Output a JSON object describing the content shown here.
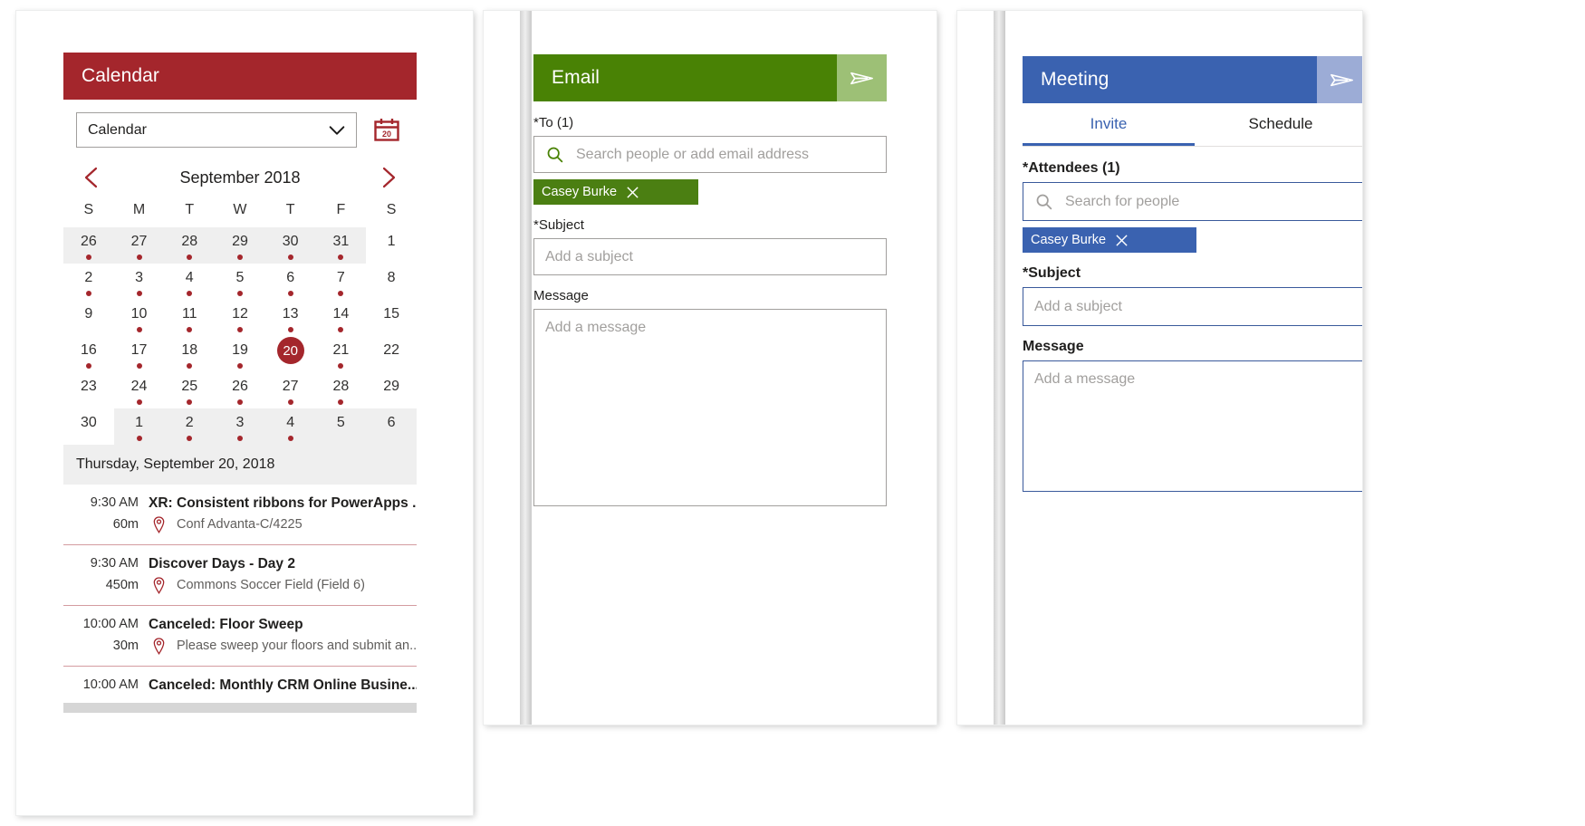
{
  "calendar_panel": {
    "header": {
      "title": "Calendar"
    },
    "selector": {
      "value": "Calendar",
      "chevron_icon": "chevron-down-icon"
    },
    "today_button": {
      "icon": "calendar-date-icon",
      "day": "20"
    },
    "month_nav": {
      "prev_icon": "chevron-left-icon",
      "next_icon": "chevron-right-icon",
      "label": "September 2018"
    },
    "weekday_headers": [
      "S",
      "M",
      "T",
      "W",
      "T",
      "F",
      "S"
    ],
    "weeks": [
      [
        {
          "n": "26",
          "other": true,
          "dot": true
        },
        {
          "n": "27",
          "other": true,
          "dot": true
        },
        {
          "n": "28",
          "other": true,
          "dot": true
        },
        {
          "n": "29",
          "other": true,
          "dot": true
        },
        {
          "n": "30",
          "other": true,
          "dot": true
        },
        {
          "n": "31",
          "other": true,
          "dot": true
        },
        {
          "n": "1",
          "other": false,
          "dot": false
        }
      ],
      [
        {
          "n": "2",
          "dot": true
        },
        {
          "n": "3",
          "dot": true
        },
        {
          "n": "4",
          "dot": true
        },
        {
          "n": "5",
          "dot": true
        },
        {
          "n": "6",
          "dot": true
        },
        {
          "n": "7",
          "dot": true
        },
        {
          "n": "8",
          "dot": false
        }
      ],
      [
        {
          "n": "9",
          "dot": false
        },
        {
          "n": "10",
          "dot": true
        },
        {
          "n": "11",
          "dot": true
        },
        {
          "n": "12",
          "dot": true
        },
        {
          "n": "13",
          "dot": true
        },
        {
          "n": "14",
          "dot": true
        },
        {
          "n": "15",
          "dot": false
        }
      ],
      [
        {
          "n": "16",
          "dot": true
        },
        {
          "n": "17",
          "dot": true
        },
        {
          "n": "18",
          "dot": true
        },
        {
          "n": "19",
          "dot": true
        },
        {
          "n": "20",
          "dot": false,
          "selected": true
        },
        {
          "n": "21",
          "dot": true
        },
        {
          "n": "22",
          "dot": false
        }
      ],
      [
        {
          "n": "23",
          "dot": false
        },
        {
          "n": "24",
          "dot": true
        },
        {
          "n": "25",
          "dot": true
        },
        {
          "n": "26",
          "dot": true
        },
        {
          "n": "27",
          "dot": true
        },
        {
          "n": "28",
          "dot": true
        },
        {
          "n": "29",
          "dot": false
        }
      ],
      [
        {
          "n": "30",
          "dot": false,
          "other": false
        },
        {
          "n": "1",
          "other": true,
          "dot": true
        },
        {
          "n": "2",
          "other": true,
          "dot": true
        },
        {
          "n": "3",
          "other": true,
          "dot": true
        },
        {
          "n": "4",
          "other": true,
          "dot": true
        },
        {
          "n": "5",
          "other": true,
          "dot": false
        },
        {
          "n": "6",
          "other": true,
          "dot": false
        }
      ]
    ],
    "selected_date_label": "Thursday, September 20, 2018",
    "events": [
      {
        "time": "9:30 AM",
        "duration": "60m",
        "title": "XR: Consistent ribbons for PowerApps ...",
        "location": "Conf Advanta-C/4225",
        "location_icon": "map-pin-icon"
      },
      {
        "time": "9:30 AM",
        "duration": "450m",
        "title": "Discover Days - Day 2",
        "location": "Commons Soccer Field (Field 6)",
        "location_icon": "map-pin-icon"
      },
      {
        "time": "10:00 AM",
        "duration": "30m",
        "title": "Canceled: Floor Sweep",
        "location": "Please sweep your floors and submit an...",
        "location_icon": "map-pin-icon"
      },
      {
        "time": "10:00 AM",
        "duration": "",
        "title": "Canceled: Monthly CRM Online Busine...",
        "location": "",
        "location_icon": "map-pin-icon"
      }
    ]
  },
  "email_panel": {
    "header": {
      "title": "Email",
      "send_icon": "send-paper-plane-icon"
    },
    "to": {
      "label": "*To (1)",
      "placeholder": "Search people or add email address",
      "search_icon": "search-icon",
      "chips": [
        {
          "name": "Casey Burke",
          "remove_icon": "close-icon"
        }
      ]
    },
    "subject": {
      "label": "*Subject",
      "placeholder": "Add a subject"
    },
    "message": {
      "label": "Message",
      "placeholder": "Add a message"
    },
    "accent": "#498205",
    "accent_light": "#9dc076"
  },
  "meeting_panel": {
    "header": {
      "title": "Meeting",
      "send_icon": "send-paper-plane-icon"
    },
    "tabs": [
      {
        "label": "Invite",
        "active": true
      },
      {
        "label": "Schedule",
        "active": false
      }
    ],
    "attendees": {
      "label": "*Attendees (1)",
      "placeholder": "Search for people",
      "search_icon": "search-icon",
      "chips": [
        {
          "name": "Casey Burke",
          "remove_icon": "close-icon"
        }
      ]
    },
    "subject": {
      "label": "*Subject",
      "placeholder": "Add a subject"
    },
    "message": {
      "label": "Message",
      "placeholder": "Add a message"
    },
    "accent": "#3a62b0",
    "accent_light": "#9cacd6"
  }
}
